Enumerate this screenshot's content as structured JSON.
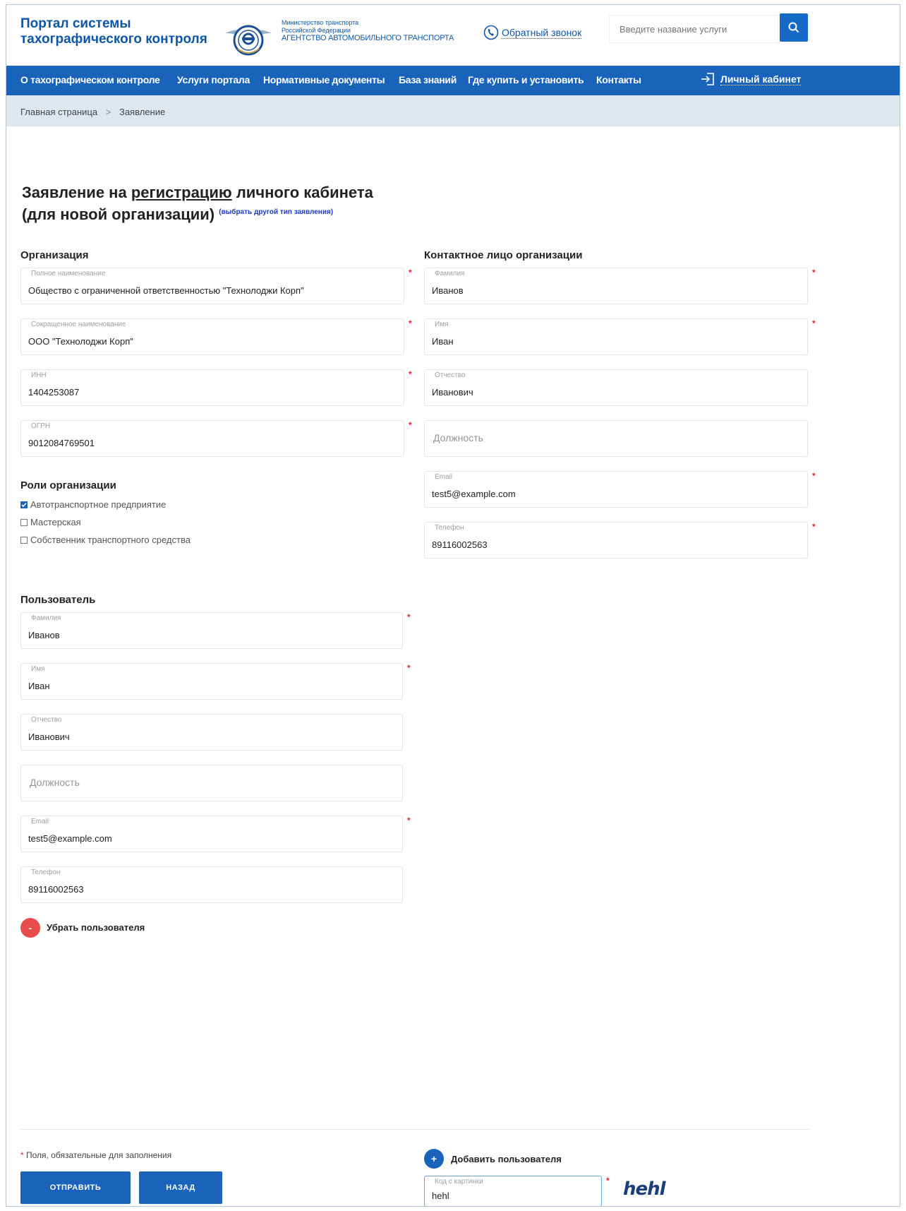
{
  "header": {
    "portal_title_line1": "Портал системы",
    "portal_title_line2": "тахографического контроля",
    "ministry_line1": "Министерство транспорта",
    "ministry_line2": "Российской Федерации",
    "agency": "АГЕНТСТВО АВТОМОБИЛЬНОГО ТРАНСПОРТА",
    "callback_label": "Обратный звонок",
    "search_placeholder": "Введите название услуги"
  },
  "nav": {
    "items": [
      {
        "label": "О тахографическом контроле"
      },
      {
        "label": "Услуги портала"
      },
      {
        "label": "Нормативные документы"
      },
      {
        "label": "База знаний"
      },
      {
        "label": "Где купить и установить"
      },
      {
        "label": "Контакты"
      }
    ],
    "cabinet_label": "Личный кабинет"
  },
  "breadcrumb": {
    "home": "Главная страница",
    "separator": ">",
    "current": "Заявление"
  },
  "page": {
    "title_pre": "Заявление на ",
    "title_link": "регистрацию",
    "title_post": " личного кабинета",
    "title_line2": "(для новой организации)",
    "switch_type": "(выбрать другой тип заявления)"
  },
  "organization": {
    "heading": "Организация",
    "full_name": {
      "label": "Полное наименование",
      "value": "Общество с ограниченной ответственностью \"Технолоджи Корп\""
    },
    "short_name": {
      "label": "Сокращенное наименование",
      "value": "ООО \"Технолоджи Корп\""
    },
    "inn": {
      "label": "ИНН",
      "value": "1404253087"
    },
    "ogrn": {
      "label": "ОГРН",
      "value": "9012084769501"
    }
  },
  "roles": {
    "heading": "Роли организации",
    "items": [
      {
        "label": "Автотранспортное предприятие",
        "checked": true
      },
      {
        "label": "Мастерская",
        "checked": false
      },
      {
        "label": "Собственник транспортного средства",
        "checked": false
      }
    ]
  },
  "contact": {
    "heading": "Контактное лицо организации",
    "surname": {
      "label": "Фамилия",
      "value": "Иванов"
    },
    "name": {
      "label": "Имя",
      "value": "Иван"
    },
    "patronymic": {
      "label": "Отчество",
      "value": "Иванович"
    },
    "position": {
      "placeholder": "Должность"
    },
    "email": {
      "label": "Email",
      "value": "test5@example.com"
    },
    "phone": {
      "label": "Телефон",
      "value": "89116002563"
    }
  },
  "user": {
    "heading": "Пользователь",
    "surname": {
      "label": "Фамилия",
      "value": "Иванов"
    },
    "name": {
      "label": "Имя",
      "value": "Иван"
    },
    "patronymic": {
      "label": "Отчество",
      "value": "Иванович"
    },
    "position": {
      "placeholder": "Должность"
    },
    "email": {
      "label": "Email",
      "value": "test5@example.com"
    },
    "phone": {
      "label": "Телефон",
      "value": "89116002563"
    },
    "remove_label": "Убрать пользователя",
    "remove_symbol": "-"
  },
  "footer": {
    "required_star": "*",
    "required_note": " Поля, обязательные для заполнения",
    "add_user_label": "Добавить пользователя",
    "add_symbol": "+",
    "captcha": {
      "label": "Код с картинки",
      "value": "hehl",
      "image_text": "hehl"
    },
    "submit_label": "ОТПРАВИТЬ",
    "back_label": "НАЗАД"
  },
  "colors": {
    "brand_blue": "#1a63bb",
    "required_red": "#e0262b",
    "remove_red": "#e84c4c"
  }
}
